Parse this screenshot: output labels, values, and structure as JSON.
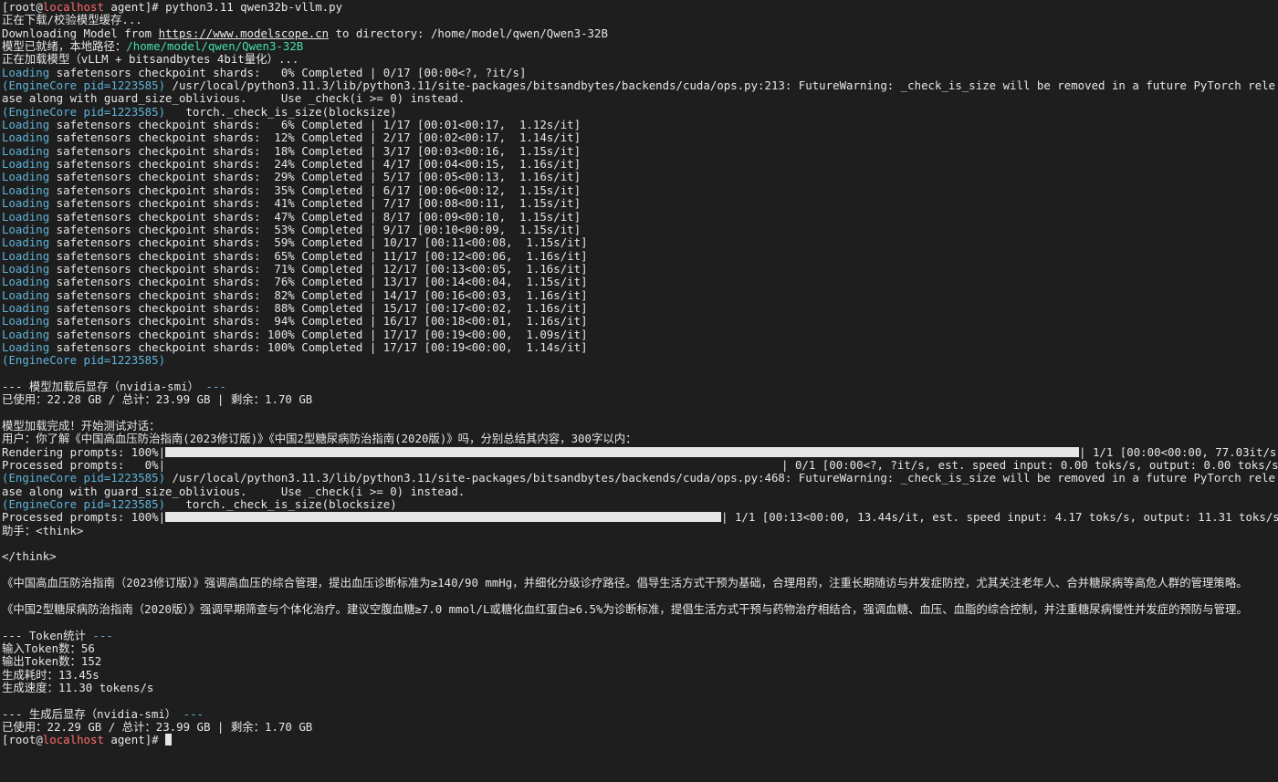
{
  "prompt": {
    "user": "root",
    "host": "localhost",
    "dir": "agent"
  },
  "command": "python3.11 qwen32b-vllm.py",
  "lines_intro": {
    "downloading_cn": "正在下载/校验模型缓存...",
    "downloading_en_prefix": "Downloading Model from ",
    "downloading_url": "https://www.modelscope.cn",
    "downloading_en_suffix": " to directory: /home/model/qwen/Qwen3-32B",
    "ready_prefix": "模型已就绪，本地路径：",
    "ready_path": "/home/model/qwen/Qwen3-32B",
    "loading_model": "正在加载模型（vLLM + bitsandbytes 4bit量化）..."
  },
  "engine_tag": "(EngineCore pid=1223585)",
  "loading_word": "Loading",
  "shards": [
    " safetensors checkpoint shards:   0% Completed | 0/17 [00:00<?, ?it/s]",
    " safetensors checkpoint shards:   6% Completed | 1/17 [00:01<00:17,  1.12s/it]",
    " safetensors checkpoint shards:  12% Completed | 2/17 [00:02<00:17,  1.14s/it]",
    " safetensors checkpoint shards:  18% Completed | 3/17 [00:03<00:16,  1.15s/it]",
    " safetensors checkpoint shards:  24% Completed | 4/17 [00:04<00:15,  1.16s/it]",
    " safetensors checkpoint shards:  29% Completed | 5/17 [00:05<00:13,  1.16s/it]",
    " safetensors checkpoint shards:  35% Completed | 6/17 [00:06<00:12,  1.15s/it]",
    " safetensors checkpoint shards:  41% Completed | 7/17 [00:08<00:11,  1.15s/it]",
    " safetensors checkpoint shards:  47% Completed | 8/17 [00:09<00:10,  1.15s/it]",
    " safetensors checkpoint shards:  53% Completed | 9/17 [00:10<00:09,  1.15s/it]",
    " safetensors checkpoint shards:  59% Completed | 10/17 [00:11<00:08,  1.15s/it]",
    " safetensors checkpoint shards:  65% Completed | 11/17 [00:12<00:06,  1.16s/it]",
    " safetensors checkpoint shards:  71% Completed | 12/17 [00:13<00:05,  1.16s/it]",
    " safetensors checkpoint shards:  76% Completed | 13/17 [00:14<00:04,  1.15s/it]",
    " safetensors checkpoint shards:  82% Completed | 14/17 [00:16<00:03,  1.16s/it]",
    " safetensors checkpoint shards:  88% Completed | 15/17 [00:17<00:02,  1.16s/it]",
    " safetensors checkpoint shards:  94% Completed | 16/17 [00:18<00:01,  1.16s/it]",
    " safetensors checkpoint shards: 100% Completed | 17/17 [00:19<00:00,  1.09s/it]",
    " safetensors checkpoint shards: 100% Completed | 17/17 [00:19<00:00,  1.14s/it]"
  ],
  "warning1": {
    "text": " /usr/local/python3.11.3/lib/python3.11/site-packages/bitsandbytes/backends/cuda/ops.py:213: FutureWarning: _check_is_size will be removed in a future PyTorch release along with guard_size_oblivious.     Use _check(i >= 0) instead."
  },
  "warning2": {
    "text": " /usr/local/python3.11.3/lib/python3.11/site-packages/bitsandbytes/backends/cuda/ops.py:468: FutureWarning: _check_is_size will be removed in a future PyTorch release along with guard_size_oblivious.     Use _check(i >= 0) instead."
  },
  "torch_check": "   torch._check_is_size(blocksize)",
  "gpu_after_load": {
    "header_prefix": "--- ",
    "header_text": "模型加载后显存（nvidia-smi）",
    "header_suffix": " ---",
    "usage": "已使用：22.28 GB / 总计：23.99 GB | 剩余：1.70 GB"
  },
  "test_start": "模型加载完成！开始测试对话：",
  "user_prompt": "用户：你了解《中国高血压防治指南(2023修订版)》《中国2型糖尿病防治指南(2020版)》吗，分别总结其内容，300字以内：",
  "rendering": {
    "label": "Rendering prompts: 100%|",
    "progress": 1.0,
    "stats": "| 1/1 [00:00<00:00, 77.03it/s]"
  },
  "processed0": {
    "label": "Processed prompts:   0%|",
    "progress": 0.0,
    "stats": "| 0/1 [00:00<?, ?it/s, est. speed input: 0.00 toks/s, output: 0.00 toks/s]"
  },
  "processed1": {
    "label": "Processed prompts: 100%|",
    "progress": 1.0,
    "stats": "| 1/1 [00:13<00:00, 13.44s/it, est. speed input: 4.17 toks/s, output: 11.31 toks/s]"
  },
  "assistant_prefix": "助手：<think>",
  "think_close": "</think>",
  "answer_p1": "《中国高血压防治指南（2023修订版）》强调高血压的综合管理，提出血压诊断标准为≥140/90 mmHg，并细化分级诊疗路径。倡导生活方式干预为基础，合理用药，注重长期随访与并发症防控，尤其关注老年人、合并糖尿病等高危人群的管理策略。",
  "answer_p2": "《中国2型糖尿病防治指南（2020版）》强调早期筛查与个体化治疗。建议空腹血糖≥7.0 mmol/L或糖化血红蛋白≥6.5%为诊断标准，提倡生活方式干预与药物治疗相结合，强调血糖、血压、血脂的综合控制，并注重糖尿病慢性并发症的预防与管理。",
  "token_stats": {
    "header_prefix": "--- ",
    "header_text": "Token统计",
    "header_suffix": " ---",
    "input": "输入Token数：56",
    "output": "输出Token数：152",
    "time": "生成耗时：13.45s",
    "speed": "生成速度：11.30 tokens/s"
  },
  "gpu_after_gen": {
    "header_prefix": "--- ",
    "header_text": "生成后显存（nvidia-smi）",
    "header_suffix": " ---",
    "usage": "已使用：22.29 GB / 总计：23.99 GB | 剩余：1.70 GB"
  },
  "colors": {
    "background": "#1e1e1e",
    "text": "#e6e6e6",
    "cyan": "#5fb3d9",
    "green": "#45e0a8",
    "host": "#ff6b6b"
  }
}
